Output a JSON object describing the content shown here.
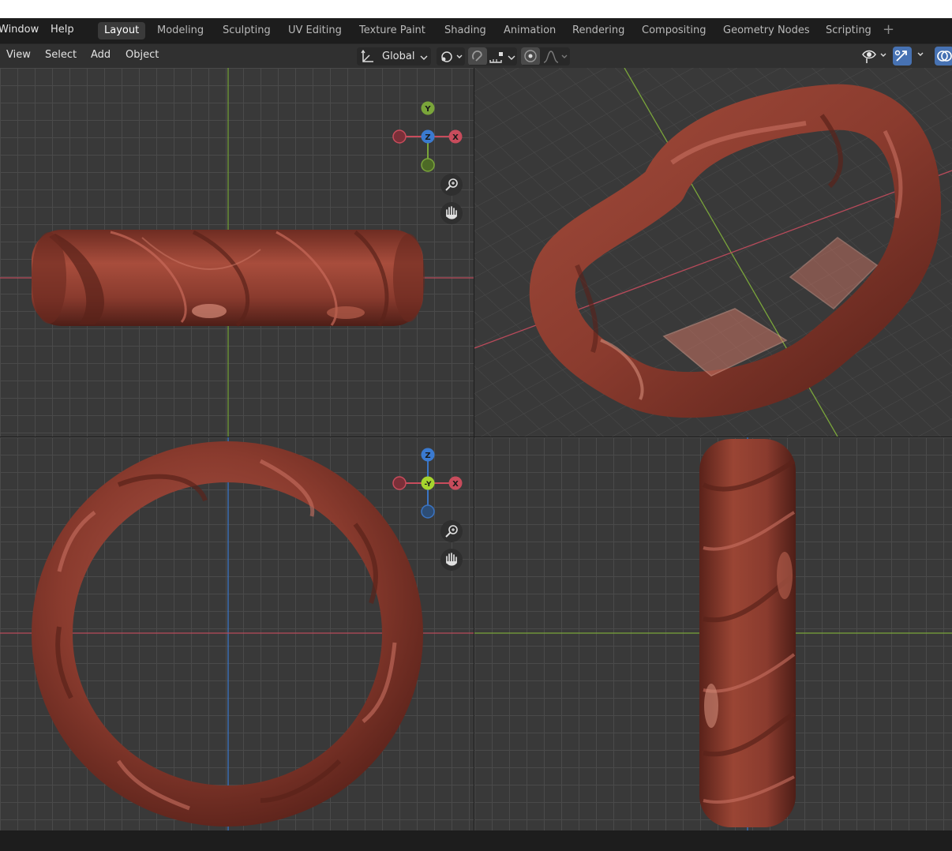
{
  "topbar": {
    "menus": [
      "Window",
      "Help"
    ],
    "tabs": [
      "Layout",
      "Modeling",
      "Sculpting",
      "UV Editing",
      "Texture Paint",
      "Shading",
      "Animation",
      "Rendering",
      "Compositing",
      "Geometry Nodes",
      "Scripting"
    ],
    "active_tab": "Layout",
    "add_tab_icon": "plus-icon"
  },
  "header": {
    "menus": [
      "View",
      "Select",
      "Add",
      "Object"
    ],
    "orientation_value": "Global",
    "icons": [
      "transform-orientation-icon",
      "pivot-icon",
      "snap-icon",
      "snap-increment-icon",
      "proportional-edit-icon",
      "falloff-curve-icon",
      "visibility-eye-icon",
      "gizmo-toggle-icon",
      "overlay-toggle-icon"
    ]
  },
  "viewports": {
    "top_view_gizmo": {
      "up": "Y",
      "center": "Z",
      "right": "X"
    },
    "front_view_gizmo": {
      "up": "Z",
      "center": "-Y",
      "right": "X"
    },
    "nav_icons": [
      "zoom-icon",
      "pan-hand-icon"
    ]
  },
  "colors": {
    "ring": "#8a3b2e",
    "ring_highlight": "#c86a5a",
    "grid_bg": "#393939",
    "axis_x": "#c84c5c",
    "axis_y": "#7aa53a",
    "axis_z": "#3a74c4",
    "active_tab_bg": "#3a3a3a"
  }
}
